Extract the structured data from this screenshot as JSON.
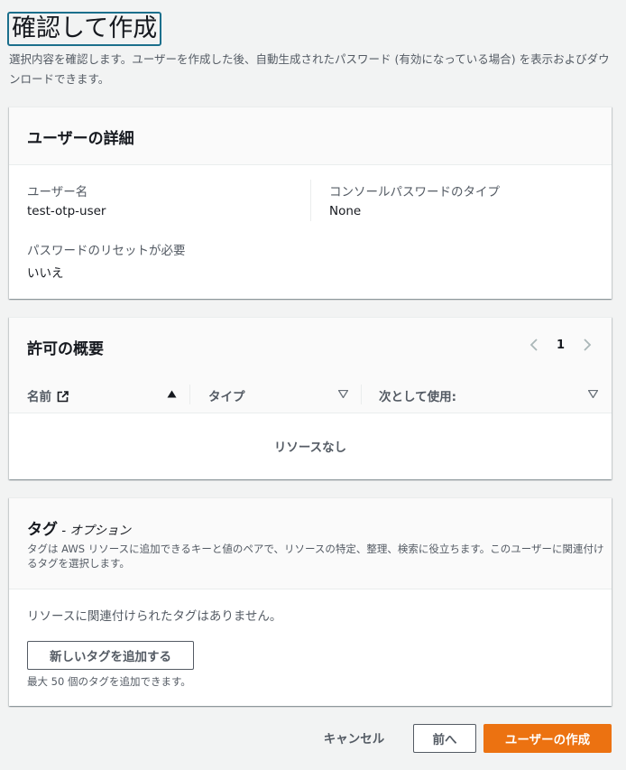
{
  "page": {
    "title": "確認して作成",
    "description": "選択内容を確認します。ユーザーを作成した後、自動生成されたパスワード (有効になっている場合) を表示およびダウンロードできます。"
  },
  "user_details": {
    "title": "ユーザーの詳細",
    "fields": [
      {
        "label": "ユーザー名",
        "value": "test-otp-user"
      },
      {
        "label": "コンソールパスワードのタイプ",
        "value": "None"
      },
      {
        "label": "パスワードのリセットが必要",
        "value": "いいえ"
      }
    ]
  },
  "permissions": {
    "title": "許可の概要",
    "page_number": "1",
    "columns": [
      "名前",
      "タイプ",
      "次として使用:"
    ],
    "empty_text": "リソースなし"
  },
  "tags": {
    "title": "タグ",
    "optional": " - オプション",
    "description": "タグは AWS リソースに追加できるキーと値のペアで、リソースの特定、整理、検索に役立ちます。このユーザーに関連付けるタグを選択します。",
    "no_tags": "リソースに関連付けられたタグはありません。",
    "add_button": "新しいタグを追加する",
    "hint": "最大 50 個のタグを追加できます。"
  },
  "footer": {
    "cancel": "キャンセル",
    "previous": "前へ",
    "create": "ユーザーの作成"
  },
  "colors": {
    "primary": "#ec7211",
    "focus": "#1b6f8c"
  }
}
